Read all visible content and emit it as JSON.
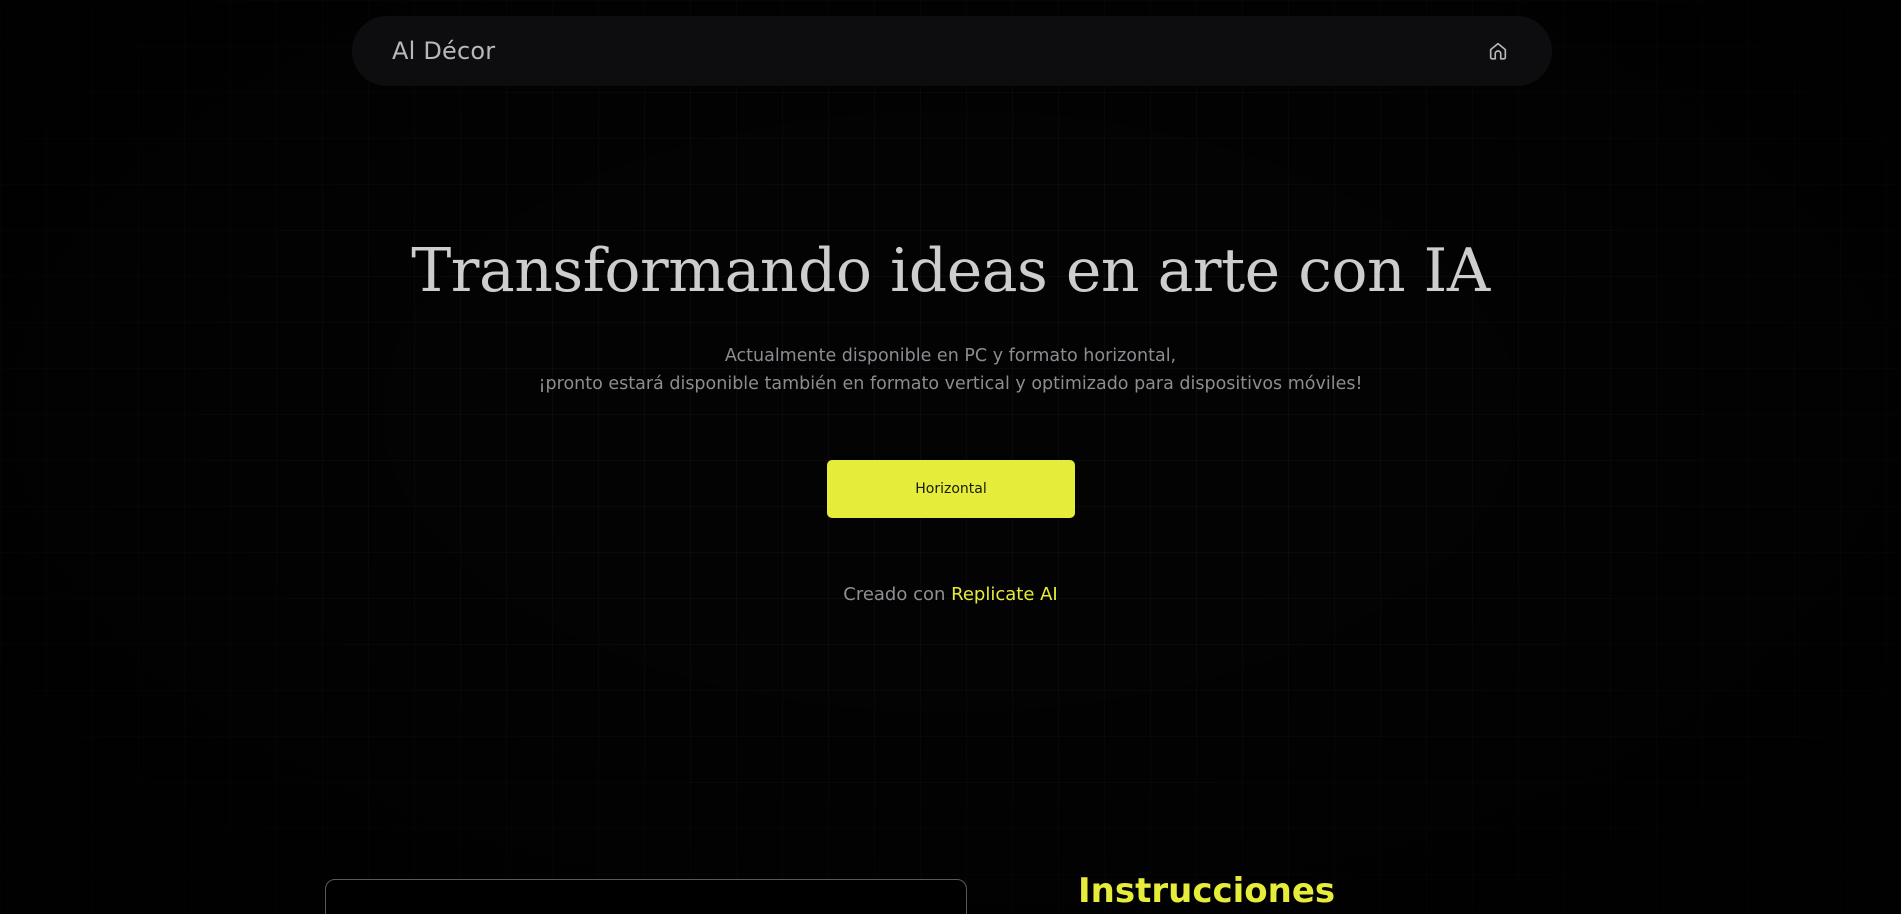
{
  "header": {
    "brand": "Al Décor",
    "home_icon": "home-icon"
  },
  "hero": {
    "title": "Transformando ideas en arte con IA",
    "subtitle_line1": "Actualmente disponible en PC y formato horizontal,",
    "subtitle_line2": "¡pronto estará disponible también en formato vertical y optimizado para dispositivos móviles!",
    "cta_label": "Horizontal"
  },
  "credit": {
    "prefix": "Creado con ",
    "link": "Replicate AI"
  },
  "instructions": {
    "heading": "Instrucciones"
  },
  "colors": {
    "accent": "#e6ec3a",
    "background": "#030303",
    "navbar": "#0d0d0f"
  }
}
